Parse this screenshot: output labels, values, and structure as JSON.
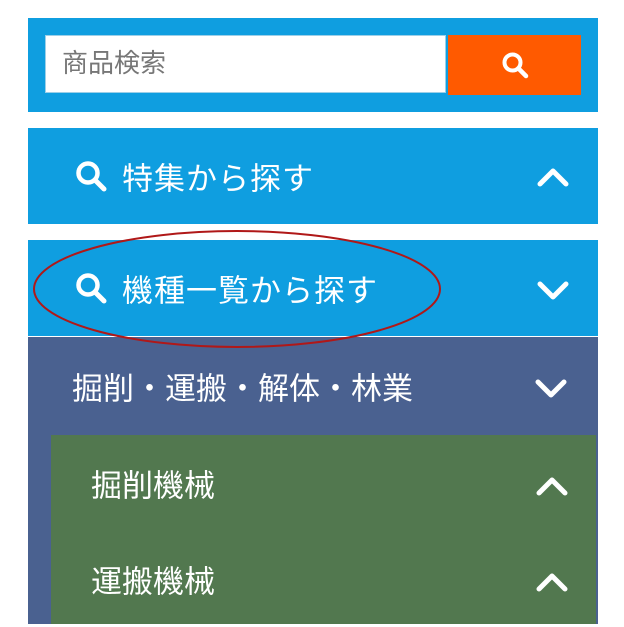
{
  "search": {
    "placeholder": "商品検索",
    "button_icon": "search-icon",
    "button_color": "#ff5a00"
  },
  "menu": [
    {
      "label": "特集から探す",
      "icon": "search-icon",
      "state": "collapsed",
      "chevron": "chevron-up-icon"
    },
    {
      "label": "機種一覧から探す",
      "icon": "search-icon",
      "state": "expanded",
      "chevron": "chevron-down-icon"
    }
  ],
  "category": {
    "label": "掘削・運搬・解体・林業",
    "chevron": "chevron-down-icon",
    "items": [
      {
        "label": "掘削機械",
        "chevron": "chevron-up-icon"
      },
      {
        "label": "運搬機械",
        "chevron": "chevron-up-icon"
      }
    ]
  },
  "colors": {
    "primary_blue": "#0f9ee0",
    "accent_orange": "#ff5a00",
    "category_navy": "#4a6190",
    "subcategory_green": "#52784f",
    "annotation_red": "#b01818"
  }
}
